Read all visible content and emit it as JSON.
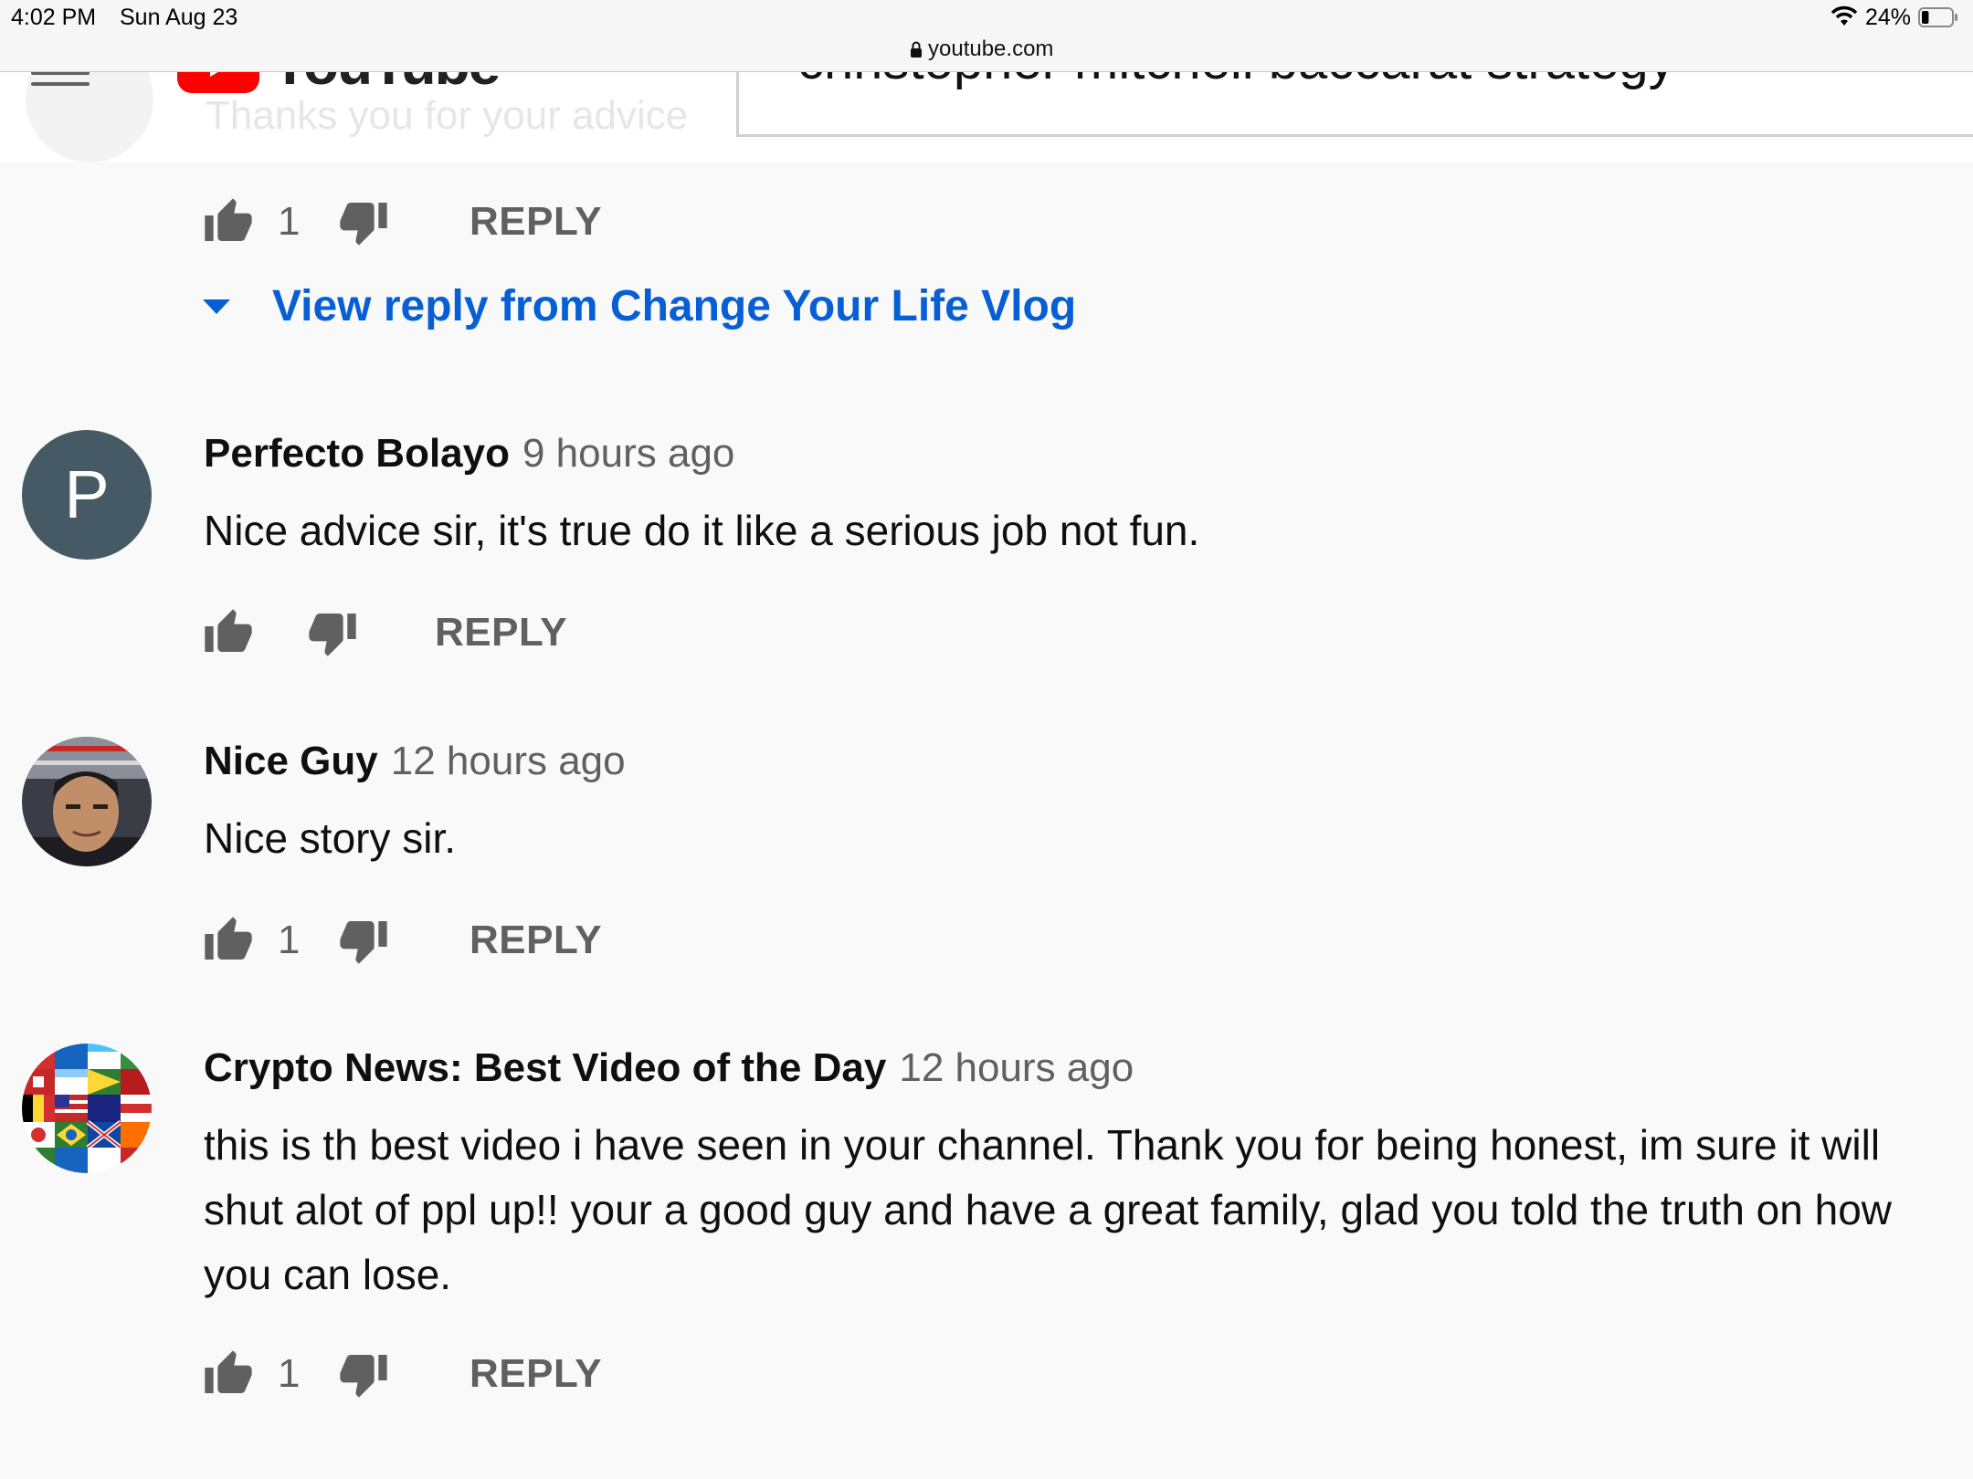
{
  "status_bar": {
    "time": "4:02 PM",
    "date": "Sun Aug 23",
    "battery_percent": "24%",
    "battery_level": 0.24
  },
  "browser": {
    "domain": "youtube.com"
  },
  "header": {
    "logo_text": "YouTube",
    "search_query": "christopher mitchell baccarat strategy",
    "ghost_comment_text": "Thanks you for your advice"
  },
  "top_actions": {
    "like_count": "1",
    "reply_label": "REPLY"
  },
  "view_reply": {
    "label": "View reply from Change Your Life Vlog"
  },
  "comments": [
    {
      "author": "Perfecto Bolayo",
      "time": "9 hours ago",
      "avatar_letter": "P",
      "avatar_color": "#455a64",
      "text": "Nice advice sir, it's true do it like a serious job not fun.",
      "like_count": "",
      "reply_label": "REPLY"
    },
    {
      "author": "Nice Guy",
      "time": "12 hours ago",
      "avatar_letter": "",
      "text": "Nice story sir.",
      "like_count": "1",
      "reply_label": "REPLY"
    },
    {
      "author": "Crypto News: Best Video of the Day",
      "time": "12 hours ago",
      "avatar_letter": "",
      "text": "this is th best video i have seen in your channel.  Thank you for being honest, im sure it will shut alot of ppl up!! your a good guy and have a great family, glad you told the truth on how you can lose.",
      "like_count": "1",
      "reply_label": "REPLY"
    }
  ],
  "colors": {
    "link_blue": "#065fd4",
    "youtube_red": "#ff0000",
    "secondary_text": "#606060",
    "page_background": "#f9f9f9"
  },
  "icons": [
    "wifi-icon",
    "battery-icon",
    "lock-icon",
    "hamburger-menu-icon",
    "thumbs-up-icon",
    "thumbs-down-icon",
    "caret-down-icon"
  ]
}
